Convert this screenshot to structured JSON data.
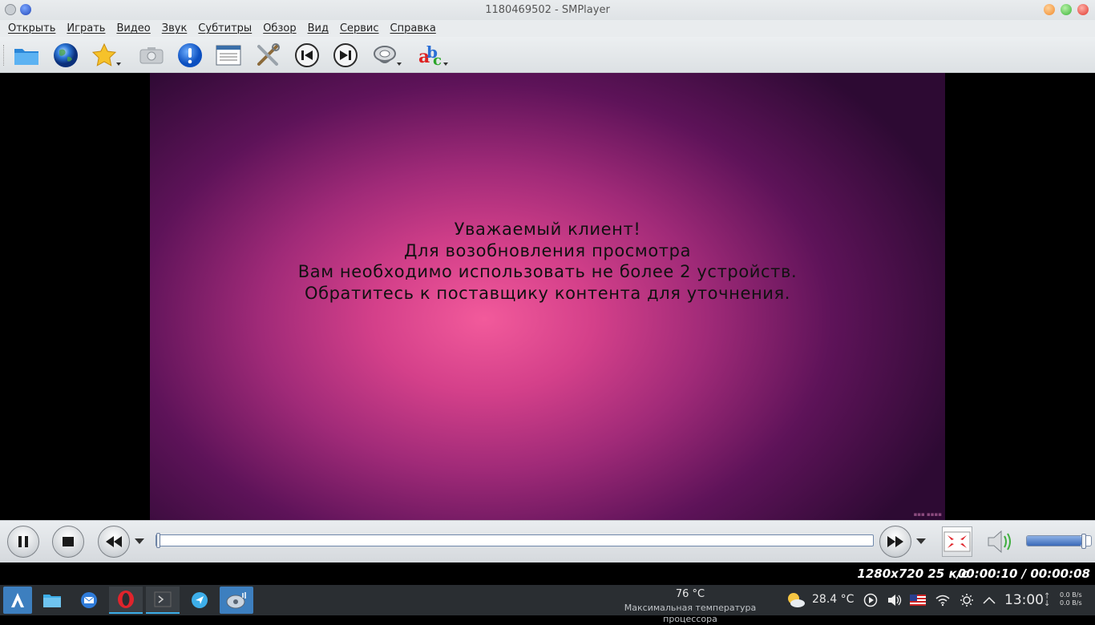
{
  "window": {
    "title": "1180469502 - SMPlayer"
  },
  "menu": [
    "Открыть",
    "Играть",
    "Видео",
    "Звук",
    "Субтитры",
    "Обзор",
    "Вид",
    "Сервис",
    "Справка"
  ],
  "toolbar": {
    "icons": [
      "folder-icon",
      "globe-icon",
      "favorites-star-icon",
      "screenshot-camera-icon",
      "info-icon",
      "playlist-icon",
      "preferences-tools-icon",
      "previous-icon",
      "next-icon",
      "audio-track-icon",
      "subtitles-icon"
    ]
  },
  "video": {
    "message_lines": [
      "Уважаемый клиент!",
      "Для возобновления просмотра",
      "Вам необходимо использовать не более 2 устройств.",
      "Обратитесь к поставщику контента для уточнения."
    ]
  },
  "controls": {
    "seek_progress": 0.0,
    "volume_level": 0.85
  },
  "status": {
    "resolution": "1280x720 25 к/с",
    "time": "00:00:10 / 00:00:08"
  },
  "taskbar": {
    "cpu_temp": "76 °C",
    "cpu_label": "Максимальная температура процессора",
    "weather_temp": "28.4 °C",
    "clock": "13:00",
    "net_up": "0.0 B/s",
    "net_down": "0.0 B/s"
  },
  "colors": {
    "accent": "#3daee9",
    "video_bg_center": "#f25a9b",
    "video_bg_edge": "#2d0a33"
  }
}
